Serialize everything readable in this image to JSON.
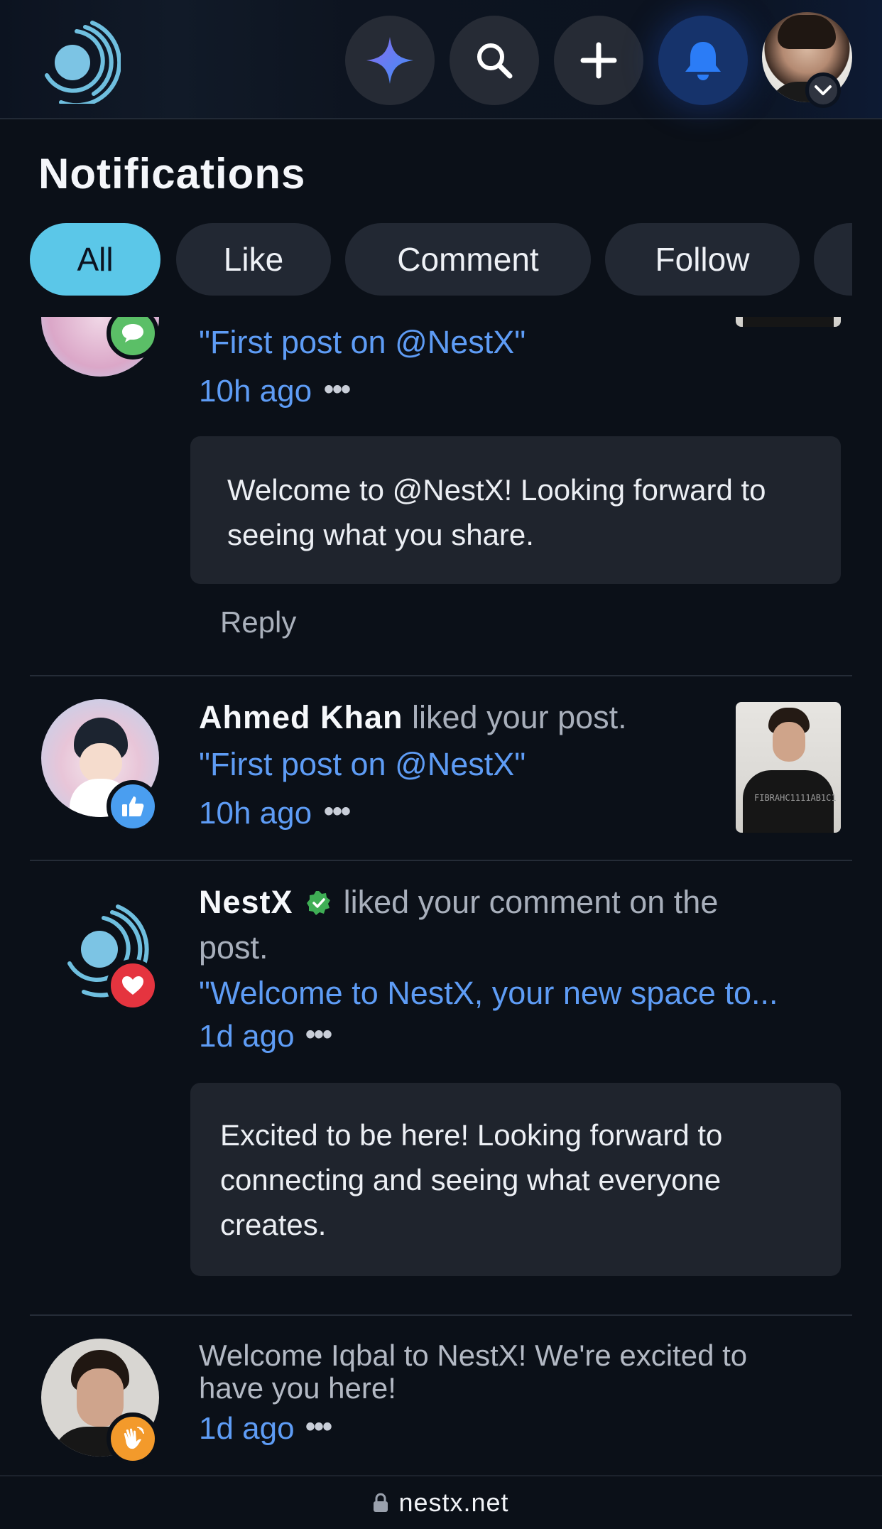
{
  "header": {
    "logo_icon": "nestx-logo-icon",
    "buttons": [
      {
        "name": "ai-sparkle-button",
        "icon": "sparkle-icon"
      },
      {
        "name": "search-button",
        "icon": "search-icon"
      },
      {
        "name": "create-button",
        "icon": "plus-icon"
      },
      {
        "name": "notifications-button",
        "icon": "bell-icon",
        "active": true
      }
    ],
    "profile_menu_icon": "chevron-down-icon",
    "accent": "#2b7cf6"
  },
  "page_title": "Notifications",
  "tabs": [
    {
      "label": "All",
      "active": true
    },
    {
      "label": "Like",
      "active": false
    },
    {
      "label": "Comment",
      "active": false
    },
    {
      "label": "Follow",
      "active": false
    }
  ],
  "notifications": [
    {
      "badge_icon": "comment-icon",
      "badge_color": "#5bbf67",
      "quote": "\"First post on @NestX\"",
      "time": "10h ago",
      "more": "•••",
      "comment": "Welcome to @NestX!  Looking forward to seeing what you share.",
      "comment_line1": "Welcome to @NestX!  Looking forward to",
      "comment_line2": "seeing what you share.",
      "reply_label": "Reply"
    },
    {
      "actor": "Ahmed Khan",
      "action": "liked your post.",
      "badge_icon": "thumbs-up-icon",
      "badge_color": "#4a9ef0",
      "quote": "\"First post on @NestX\"",
      "time": "10h ago",
      "more": "•••"
    },
    {
      "actor": "NestX",
      "verified_icon": "verified-badge-icon",
      "action_line1": "liked your comment on the",
      "action_line2": "post.",
      "badge_icon": "heart-icon",
      "badge_color": "#e5343f",
      "quote": "\"Welcome to NestX, your new space to...",
      "time": "1d ago",
      "more": "•••",
      "comment_line1": "Excited to be here!  Looking forward to",
      "comment_line2": "connecting and seeing what everyone",
      "comment_line3": "creates."
    },
    {
      "text_line1": "Welcome Iqbal to NestX! We're excited to",
      "text_line2": "have you here!",
      "badge_icon": "waving-hand-icon",
      "badge_color": "#f39a2b",
      "time": "1d ago",
      "more": "•••"
    }
  ],
  "url_bar": {
    "lock_icon": "lock-icon",
    "url": "nestx.net"
  }
}
